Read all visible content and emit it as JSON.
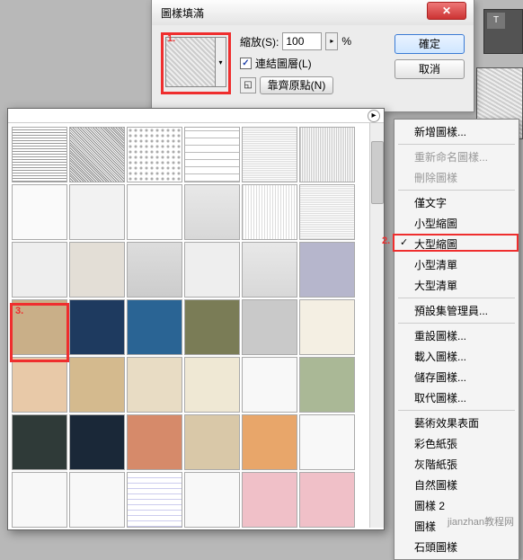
{
  "dialog": {
    "title": "圖樣填滿",
    "scale_label": "縮放(S):",
    "scale_value": "100",
    "scale_unit": "%",
    "link_layers": "連結圖層(L)",
    "snap_origin": "靠齊原點(N)",
    "ok": "確定",
    "cancel": "取消"
  },
  "annotations": {
    "one": "1.",
    "two": "2.",
    "three": "3."
  },
  "menu": {
    "new_pattern": "新增圖樣...",
    "rename_pattern": "重新命名圖樣...",
    "delete_pattern": "刪除圖樣",
    "text_only": "僅文字",
    "small_thumb": "小型縮圖",
    "large_thumb": "大型縮圖",
    "small_list": "小型清單",
    "large_list": "大型清單",
    "preset_manager": "預設集管理員...",
    "reset_patterns": "重設圖樣...",
    "load_patterns": "載入圖樣...",
    "save_patterns": "儲存圖樣...",
    "replace_patterns": "取代圖樣...",
    "artist_surfaces": "藝術效果表面",
    "color_paper": "彩色紙張",
    "grayscale_paper": "灰階紙張",
    "nature_patterns": "自然圖樣",
    "patterns_2": "圖樣 2",
    "patterns": "圖樣",
    "rock_patterns": "石頭圖樣"
  },
  "toolbar": {
    "text_tool": "T"
  },
  "watermark": "jianzhan教程网"
}
